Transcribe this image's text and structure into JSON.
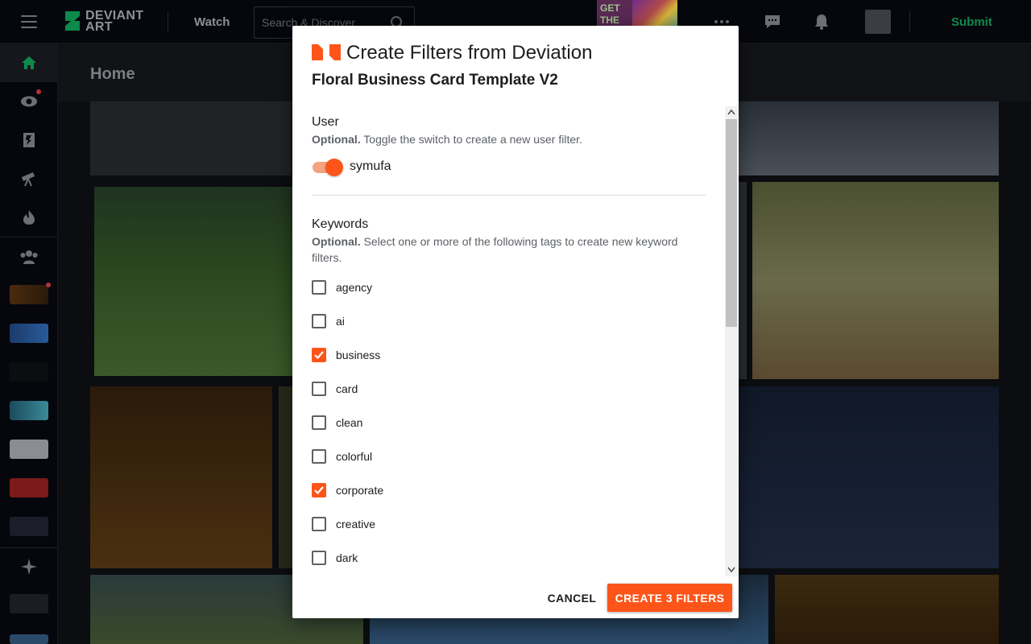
{
  "topbar": {
    "logo_text_1": "DEVIANT",
    "logo_text_2": "ART",
    "watch_label": "Watch",
    "search_placeholder": "Search & Discover",
    "promo_text_1": "GET",
    "promo_text_2": "THE",
    "submit_label": "Submit",
    "brand_color": "#0d8a4b"
  },
  "sidebar": {
    "items": [
      "home-icon",
      "watch-eye-icon",
      "deviation-icon",
      "telescope-icon",
      "fire-icon",
      "groups-icon",
      "star-icon"
    ]
  },
  "page": {
    "title": "Home"
  },
  "modal": {
    "title": "Create Filters from Deviation",
    "subtitle": "Floral Business Card Template V2",
    "accent_color": "#fd5519",
    "user_section": {
      "title": "User",
      "desc_bold": "Optional.",
      "desc_text": " Toggle the switch to create a new user filter.",
      "username": "symufa",
      "toggle_on": true
    },
    "keywords_section": {
      "title": "Keywords",
      "desc_bold": "Optional.",
      "desc_text": " Select one or more of the following tags to create new keyword filters."
    },
    "keywords": [
      {
        "label": "agency",
        "checked": false
      },
      {
        "label": "ai",
        "checked": false
      },
      {
        "label": "business",
        "checked": true
      },
      {
        "label": "card",
        "checked": false
      },
      {
        "label": "clean",
        "checked": false
      },
      {
        "label": "colorful",
        "checked": false
      },
      {
        "label": "corporate",
        "checked": true
      },
      {
        "label": "creative",
        "checked": false
      },
      {
        "label": "dark",
        "checked": false
      }
    ],
    "cancel_label": "CANCEL",
    "create_label": "CREATE 3 FILTERS"
  }
}
